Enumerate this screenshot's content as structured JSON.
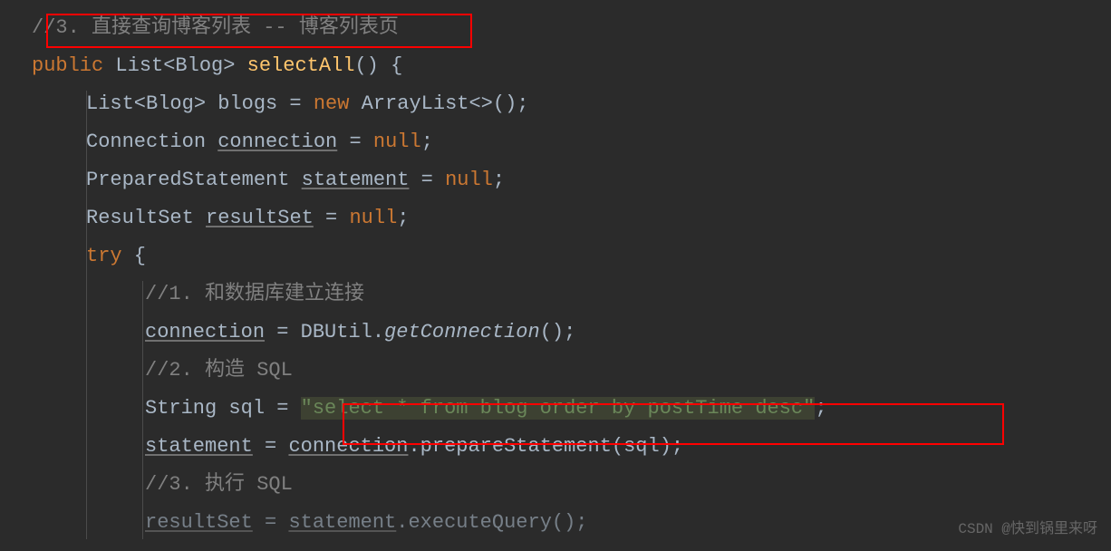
{
  "code": {
    "line1_comment": "//3. 直接查询博客列表 -- 博客列表页",
    "line2_public": "public",
    "line2_type": " List<Blog> ",
    "line2_method": "selectAll",
    "line2_paren": "() {",
    "line3_a": "List<Blog> blogs = ",
    "line3_new": "new",
    "line3_b": " ArrayList<>();",
    "line4_a": "Connection ",
    "line4_var": "connection",
    "line4_b": " = ",
    "line4_null": "null",
    "line4_c": ";",
    "line5_a": "PreparedStatement ",
    "line5_var": "statement",
    "line5_b": " = ",
    "line5_null": "null",
    "line5_c": ";",
    "line6_a": "ResultSet ",
    "line6_var": "resultSet",
    "line6_b": " = ",
    "line6_null": "null",
    "line6_c": ";",
    "line7_try": "try",
    "line7_b": " {",
    "line8_comment": "//1. 和数据库建立连接",
    "line9_var": "connection",
    "line9_a": " = DBUtil.",
    "line9_method": "getConnection",
    "line9_b": "();",
    "line10_comment": "//2. 构造 SQL",
    "line11_a": "String sql = ",
    "line11_str": "\"select * from blog order by postTime desc\"",
    "line11_b": ";",
    "line12_var1": "statement",
    "line12_a": " = ",
    "line12_var2": "connection",
    "line12_b": ".prepareStatement(sql);",
    "line13_comment": "//3. 执行 SQL",
    "line14_var1": "resultSet",
    "line14_a": " = ",
    "line14_var2": "statement",
    "line14_b": ".executeQuery();"
  },
  "watermark": "CSDN @快到锅里来呀"
}
